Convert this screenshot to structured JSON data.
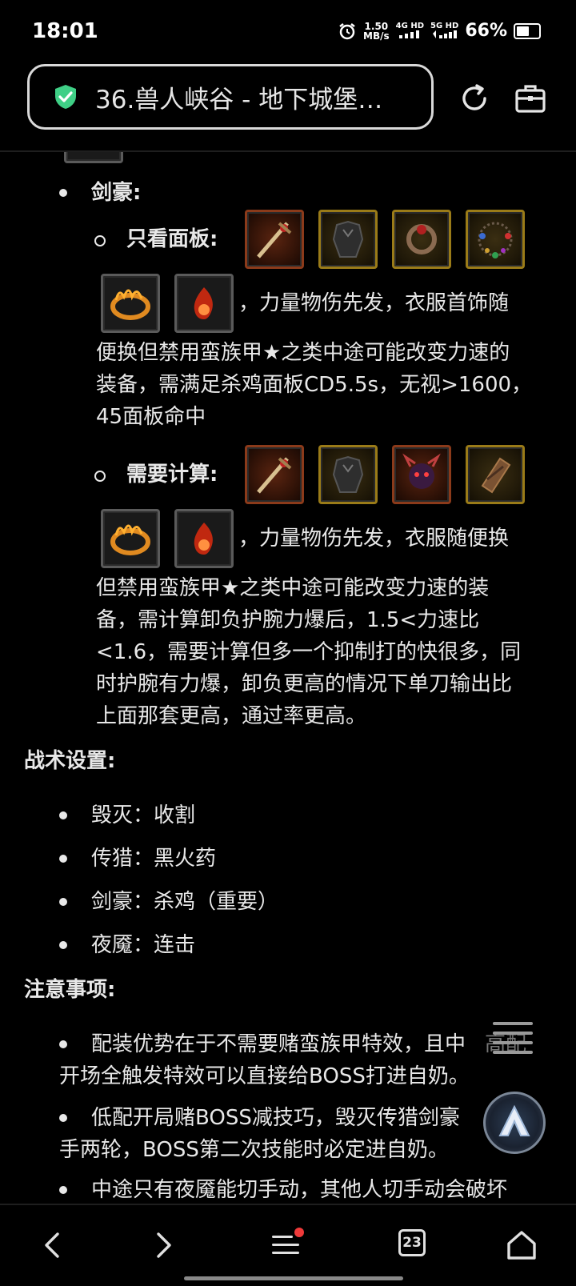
{
  "status_bar": {
    "time": "18:01",
    "net_speed_value": "1.50",
    "net_speed_unit": "MB/s",
    "net_4g": "4G HD",
    "net_5g": "5G HD",
    "battery_percent": "66%",
    "battery_level": 0.66
  },
  "header": {
    "page_title": "36.兽人峡谷 - 地下城堡…"
  },
  "content": {
    "sword_bullet": "剑豪:",
    "panel_only_label": "只看面板:",
    "panel_only_line1": "，力量物伤先发，衣服首饰随",
    "panel_only_line2": "便换但禁用蛮族甲★之类中途可能改变力速的",
    "panel_only_line3": "装备，需满足杀鸡面板CD5.5s，无视>1600，",
    "panel_only_line4": "45面板命中",
    "calc_label": "需要计算:",
    "calc_line1": "，力量物伤先发，衣服随便换",
    "calc_line2": "但禁用蛮族甲★之类中途可能改变力速的装",
    "calc_line3": "备，需计算卸负护腕力爆后，1.5<力速比",
    "calc_line4": "<1.6，需要计算但多一个抑制打的快很多，同",
    "calc_line5": "时护腕有力爆，卸负更高的情况下单刀输出比",
    "calc_line6": "上面那套更高，通过率更高。",
    "tactics_heading": "战术设置:",
    "tactics": [
      "毁灭：收割",
      "传猎：黑火药",
      "剑豪：杀鸡（重要）",
      "夜魇：连击"
    ],
    "notes_heading": "注意事项:",
    "note1_line1": "配装优势在于不需要赌蛮族甲特效，且中",
    "note1_line1_faded": "高配",
    "note1_line2": "开场全触发特效可以直接给BOSS打进自奶。",
    "note2_line1": "低配开局赌BOSS减技巧，毁灭传猎剑豪",
    "note2_line2": "手两轮，BOSS第二次技能时必定进自奶。",
    "note3_partial": "中途只有夜魇能切手动，其他人切手动会破坏"
  },
  "item_icons": {
    "row1": [
      "sword-icon",
      "armor-icon",
      "ring-icon",
      "necklace-icon"
    ],
    "row2": [
      "flame-crown-icon",
      "fire-orb-icon"
    ],
    "row3": [
      "sword-icon",
      "armor-icon",
      "demon-icon",
      "bracer-icon"
    ],
    "row4": [
      "flame-crown-icon",
      "fire-orb-icon"
    ]
  },
  "navbar": {
    "tab_count": "23"
  }
}
